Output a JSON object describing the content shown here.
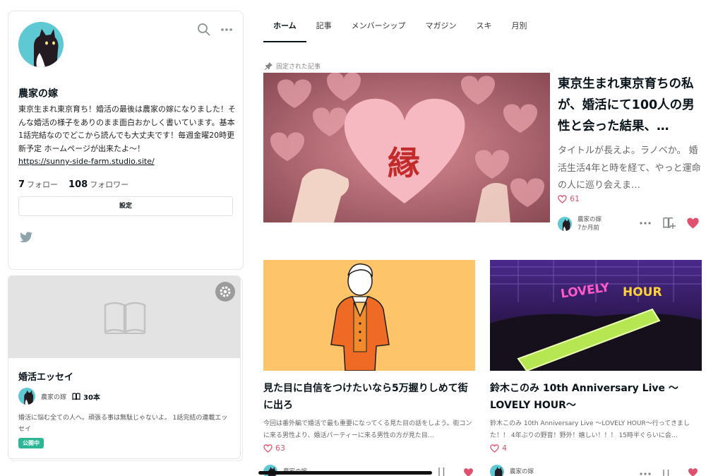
{
  "profile": {
    "name": "農家の嫁",
    "bio": "東京生まれ東京育ち！婚活の最後は農家の嫁になりました！そんな婚活の様子をありのまま面白おかしく書いています。基本1話完結なのでどこから読んでも大丈夫です！毎週金曜20時更新予定 ホームページが出来たよ〜！",
    "link": "https://sunny-side-farm.studio.site/",
    "follow_count": "7",
    "follow_label": "フォロー",
    "follower_count": "108",
    "follower_label": "フォロワー",
    "settings_label": "設定"
  },
  "magazine": {
    "title": "婚活エッセイ",
    "author": "農家の嫁",
    "count": "30本",
    "description": "婚活に悩む全ての人へ。頑張る事は無駄じゃないよ。 1話完結の連載エッセイ",
    "badge": "公開中"
  },
  "tabs": [
    "ホーム",
    "記事",
    "メンバーシップ",
    "マガジン",
    "スキ",
    "月別"
  ],
  "pinned": {
    "label": "固定された記事",
    "image_text": "縁",
    "title": "東京生まれ東京育ちの私が、婚活にて100人の男性と会った結果、…",
    "excerpt": "タイトルが長えよ。ラノベか。 婚活生活4年と時を経て、やっと運命の人に巡り会えま…",
    "likes": "61",
    "author": "農家の嫁",
    "time": "7か月前"
  },
  "cards": [
    {
      "title": "見た目に自信をつけたいなら5万握りしめて街に出ろ",
      "excerpt": "今回は番外編で婚活で最も重要になってくる見た目の話をしよう。街コンに来る男性より、婚活パーティーに来る男性の方が見た目…",
      "likes": "63",
      "author": "農家の嫁"
    },
    {
      "title": "鈴木このみ 10th Anniversary Live 〜LOVELY HOUR〜",
      "excerpt": "鈴木このみ 10th Anniversary Live 〜LOVELY HOUR〜行ってきました！！ 4年ぶりの野音！野外！嬉しい！！！ 15時半ぐらいに会…",
      "likes": "4",
      "author": "農家の嫁",
      "image_text_1": "LOVELY",
      "image_text_2": "HOUR"
    }
  ],
  "colors": {
    "accent_like": "#e0516d",
    "avatar_bg": "#5ec8d3",
    "badge_green": "#2cb696"
  }
}
